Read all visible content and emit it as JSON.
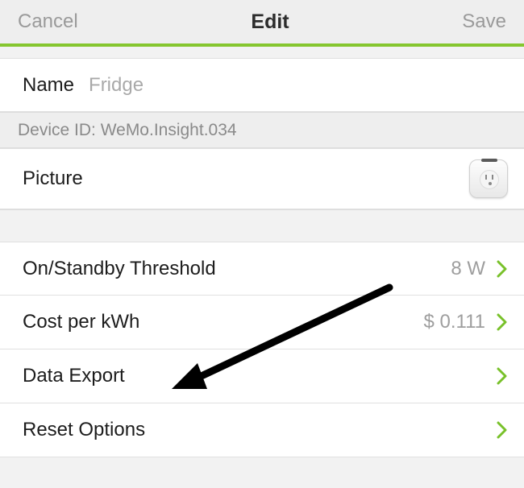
{
  "header": {
    "cancel": "Cancel",
    "title": "Edit",
    "save": "Save"
  },
  "name": {
    "label": "Name",
    "value": "Fridge"
  },
  "device_id": {
    "text": "Device ID: WeMo.Insight.034"
  },
  "picture": {
    "label": "Picture",
    "icon": "smart-plug-icon"
  },
  "rows": {
    "threshold": {
      "label": "On/Standby Threshold",
      "value": "8 W"
    },
    "cost": {
      "label": "Cost per kWh",
      "value": "$ 0.111"
    },
    "export": {
      "label": "Data Export"
    },
    "reset": {
      "label": "Reset Options"
    }
  },
  "colors": {
    "accent": "#85c62f",
    "chevron": "#78c12a"
  }
}
